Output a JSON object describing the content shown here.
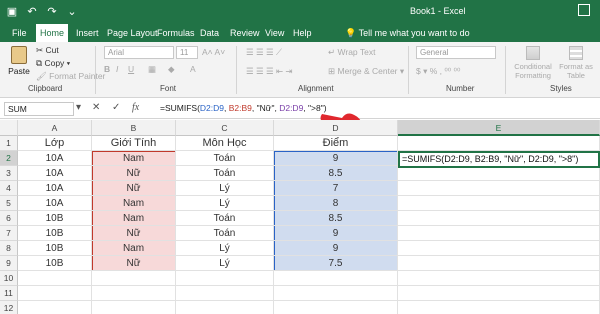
{
  "window": {
    "title": "Book1  -  Excel",
    "brand_color": "#217346"
  },
  "tabs": [
    {
      "label": "File"
    },
    {
      "label": "Home"
    },
    {
      "label": "Insert"
    },
    {
      "label": "Page Layout"
    },
    {
      "label": "Formulas"
    },
    {
      "label": "Data"
    },
    {
      "label": "Review"
    },
    {
      "label": "View"
    },
    {
      "label": "Help"
    }
  ],
  "tell_me": "Tell me what you want to do",
  "ribbon": {
    "clipboard": {
      "paste": "Paste",
      "cut": "Cut",
      "copy": "Copy",
      "format_painter": "Format Painter",
      "label": "Clipboard"
    },
    "font": {
      "name": "Arial",
      "size": "11",
      "label": "Font"
    },
    "alignment": {
      "wrap": "Wrap Text",
      "merge": "Merge & Center",
      "label": "Alignment"
    },
    "number": {
      "format": "General",
      "label": "Number"
    },
    "styles": {
      "conditional": "Conditional",
      "conditional2": "Formatting",
      "format_as": "Format as",
      "format_as2": "Table",
      "label": "Styles"
    }
  },
  "formula_bar": {
    "name_box": "SUM",
    "prefix": "=SUMIFS(",
    "arg1": "D2:D9",
    "sep1": ", ",
    "arg2": "B2:B9",
    "sep2": ", \"Nữ\", ",
    "arg3": "D2:D9",
    "suffix": ", \">8\")"
  },
  "grid": {
    "columns": [
      "A",
      "B",
      "C",
      "D",
      "E"
    ],
    "rows": [
      "1",
      "2",
      "3",
      "4",
      "5",
      "6",
      "7",
      "8",
      "9",
      "10",
      "11",
      "12"
    ],
    "headers": [
      "Lớp",
      "Giới Tính",
      "Môn Học",
      "Điểm"
    ],
    "data": [
      [
        "10A",
        "Nam",
        "Toán",
        "9"
      ],
      [
        "10A",
        "Nữ",
        "Toán",
        "8.5"
      ],
      [
        "10A",
        "Nữ",
        "Lý",
        "7"
      ],
      [
        "10A",
        "Nam",
        "Lý",
        "8"
      ],
      [
        "10B",
        "Nam",
        "Toán",
        "8.5"
      ],
      [
        "10B",
        "Nữ",
        "Toán",
        "9"
      ],
      [
        "10B",
        "Nam",
        "Lý",
        "9"
      ],
      [
        "10B",
        "Nữ",
        "Lý",
        "7.5"
      ]
    ],
    "active_cell_text": "=SUMIFS(D2:D9, B2:B9, \"Nữ\", D2:D9, \">8\")"
  }
}
